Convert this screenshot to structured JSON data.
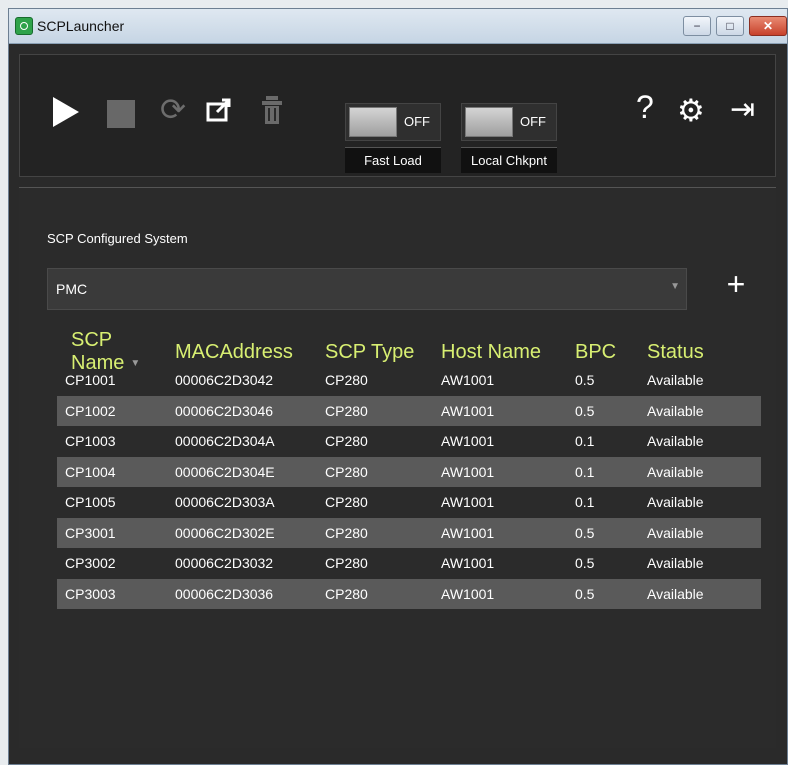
{
  "window": {
    "title": "SCPLauncher"
  },
  "toolbar": {
    "buttons": [
      {
        "name": "play-icon"
      },
      {
        "name": "stop-icon"
      },
      {
        "name": "refresh-icon"
      },
      {
        "name": "export-icon"
      },
      {
        "name": "trash-icon"
      }
    ],
    "fast_load": {
      "state": "OFF",
      "label": "Fast Load"
    },
    "local_chkpnt": {
      "state": "OFF",
      "label": "Local Chkpnt"
    },
    "help_symbol": "?"
  },
  "section": {
    "title": "SCP Configured System",
    "selected_system": "PMC",
    "plus_label": "+"
  },
  "table": {
    "headers": [
      "SCP Name",
      "MACAddress",
      "SCP Type",
      "Host Name",
      "BPC",
      "Status"
    ],
    "rows": [
      [
        "CP1001",
        "00006C2D3042",
        "CP280",
        "AW1001",
        "0.5",
        "Available"
      ],
      [
        "CP1002",
        "00006C2D3046",
        "CP280",
        "AW1001",
        "0.5",
        "Available"
      ],
      [
        "CP1003",
        "00006C2D304A",
        "CP280",
        "AW1001",
        "0.1",
        "Available"
      ],
      [
        "CP1004",
        "00006C2D304E",
        "CP280",
        "AW1001",
        "0.1",
        "Available"
      ],
      [
        "CP1005",
        "00006C2D303A",
        "CP280",
        "AW1001",
        "0.1",
        "Available"
      ],
      [
        "CP3001",
        "00006C2D302E",
        "CP280",
        "AW1001",
        "0.5",
        "Available"
      ],
      [
        "CP3002",
        "00006C2D3032",
        "CP280",
        "AW1001",
        "0.5",
        "Available"
      ],
      [
        "CP3003",
        "00006C2D3036",
        "CP280",
        "AW1001",
        "0.5",
        "Available"
      ]
    ]
  },
  "colors": {
    "header_accent": "#d8ef72",
    "toolbar_bg": "#232323",
    "content_bg": "#2b2b2b",
    "alt_row_bg": "#5a5a5a"
  }
}
